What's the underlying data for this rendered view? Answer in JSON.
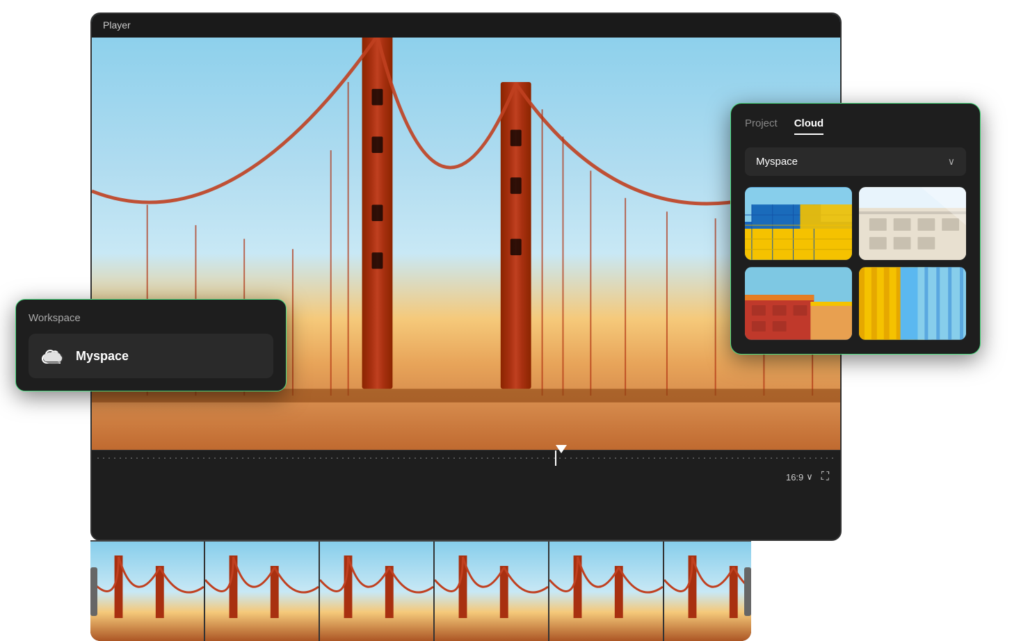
{
  "player": {
    "title": "Player",
    "aspect_ratio": "16:9",
    "aspect_ratio_arrow": "∨",
    "fullscreen_icon": "⛶"
  },
  "workspace_popup": {
    "title": "Workspace",
    "item_label": "Myspace",
    "cloud_icon": "☁"
  },
  "cloud_panel": {
    "tab_project": "Project",
    "tab_cloud": "Cloud",
    "active_tab": "Cloud",
    "dropdown_label": "Myspace",
    "dropdown_arrow": "∨",
    "thumbnails": [
      {
        "id": 1,
        "alt": "Blue yellow building"
      },
      {
        "id": 2,
        "alt": "Beige building"
      },
      {
        "id": 3,
        "alt": "Red orange building"
      },
      {
        "id": 4,
        "alt": "Yellow teal diagonal"
      }
    ]
  },
  "filmstrip": {
    "frame_count": 6
  }
}
